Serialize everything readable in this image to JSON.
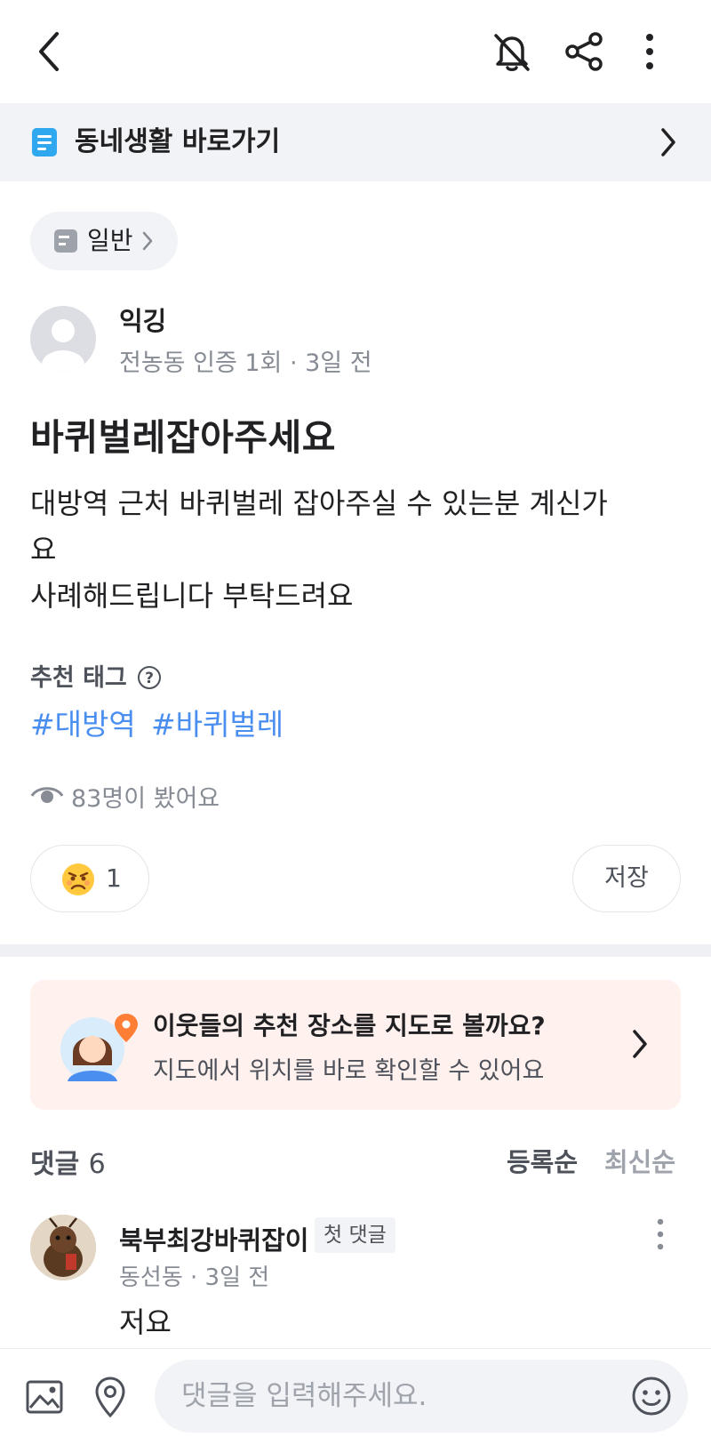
{
  "topbar": {
    "back_icon": "chevron-left-icon",
    "bell_icon": "bell-off-icon",
    "share_icon": "share-icon",
    "more_icon": "more-vertical-icon"
  },
  "shortcut": {
    "icon": "document-icon",
    "label": "동네생활 바로가기",
    "arrow_icon": "chevron-right-icon"
  },
  "category": {
    "icon": "board-icon",
    "label": "일반"
  },
  "post": {
    "author": "익깅",
    "meta": "전농동 인증 1회 · 3일 전",
    "title": "바퀴벌레잡아주세요",
    "body_lines": [
      "대방역 근처 바퀴벌레 잡아주실 수 있는분 계신가",
      "요",
      "사례해드립니다 부탁드려요"
    ],
    "tags_title": "추천 태그",
    "tags": [
      "#대방역",
      "#바퀴벌레"
    ],
    "views": "83명이 봤어요",
    "reaction_count": "1",
    "save_label": "저장"
  },
  "promo": {
    "title": "이웃들의 추천 장소를 지도로 볼까요?",
    "subtitle": "지도에서 위치를 바로 확인할 수 있어요"
  },
  "comments": {
    "label": "댓글",
    "count": "6",
    "sort_registered": "등록순",
    "sort_latest": "최신순",
    "items": [
      {
        "author": "북부최강바퀴잡이",
        "badge": "첫 댓글",
        "meta": "동선동 · 3일 전",
        "text": "저요"
      }
    ]
  },
  "bottombar": {
    "placeholder": "댓글을 입력해주세요."
  },
  "colors": {
    "accent_tag": "#4a8ef0",
    "banner_bg": "#f2f3f6",
    "promo_bg": "#fff1ee",
    "pin": "#ff7e36"
  }
}
